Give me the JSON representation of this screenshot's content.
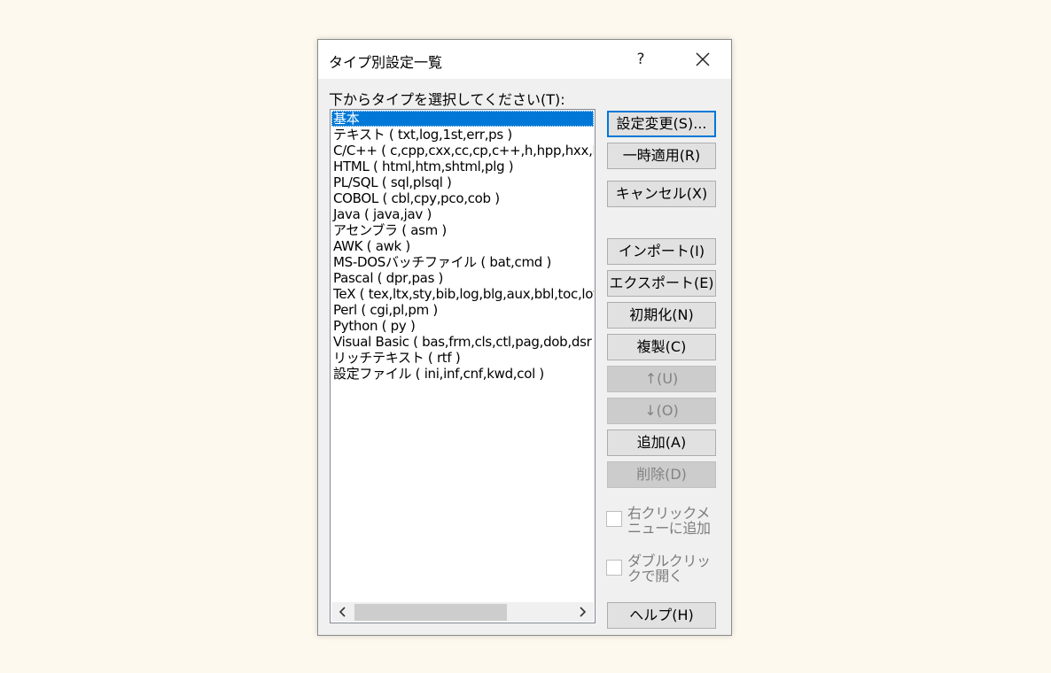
{
  "dialog": {
    "title": "タイプ別設定一覧",
    "help_label": "?",
    "prompt": "下からタイプを選択してください(T):"
  },
  "list": {
    "items": [
      "基本",
      "テキスト ( txt,log,1st,err,ps )",
      "C/C++ ( c,cpp,cxx,cc,cp,c++,h,hpp,hxx,hh",
      "HTML ( html,htm,shtml,plg )",
      "PL/SQL ( sql,plsql )",
      "COBOL ( cbl,cpy,pco,cob )",
      "Java ( java,jav )",
      "アセンブラ ( asm )",
      "AWK ( awk )",
      "MS-DOSバッチファイル ( bat,cmd )",
      "Pascal ( dpr,pas )",
      "TeX ( tex,ltx,sty,bib,log,blg,aux,bbl,toc,lof",
      "Perl ( cgi,pl,pm )",
      "Python ( py )",
      "Visual Basic ( bas,frm,cls,ctl,pag,dob,dsr",
      "リッチテキスト ( rtf )",
      "設定ファイル ( ini,inf,cnf,kwd,col )"
    ],
    "selected_index": 0
  },
  "buttons": {
    "settings": "設定変更(S)...",
    "apply_temp": "一時適用(R)",
    "cancel": "キャンセル(X)",
    "import": "インポート(I)",
    "export": "エクスポート(E)",
    "initialize": "初期化(N)",
    "duplicate": "複製(C)",
    "up": "↑(U)",
    "down": "↓(O)",
    "add": "追加(A)",
    "delete": "削除(D)",
    "help": "ヘルプ(H)"
  },
  "checkboxes": {
    "right_click_menu": "右クリックメニューに追加",
    "double_click_open": "ダブルクリックで開く"
  }
}
